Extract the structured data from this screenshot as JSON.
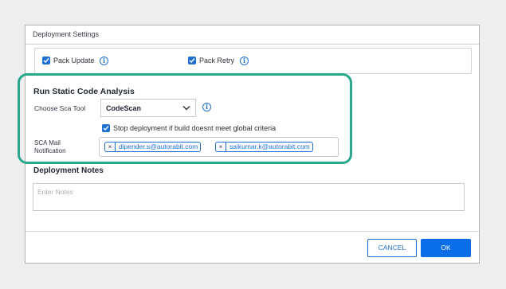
{
  "dialog": {
    "section_title": "Deployment Settings",
    "options": {
      "pack_update": {
        "label": "Pack Update",
        "checked": true
      },
      "pack_retry": {
        "label": "Pack Retry",
        "checked": true
      },
      "info_icon": "i"
    },
    "sca": {
      "title": "Run Static Code Analysis",
      "tool_label": "Choose Sca Tool",
      "tool_value": "CodeScan",
      "stop_deploy": {
        "label": "Stop deployment if build doesnt meet global criteria",
        "checked": true
      },
      "mail_label_line1": "SCA Mail",
      "mail_label_line2": "Notification",
      "emails": [
        "dipender.s@autorabit.com",
        "saikumar.k@autorabit.com"
      ],
      "remove_glyph": "×"
    },
    "notes": {
      "title": "Deployment Notes",
      "placeholder": "Enter Notes"
    },
    "footer": {
      "cancel_label": "CANCEL",
      "ok_label": "OK"
    }
  },
  "colors": {
    "accent": "#1f6fd1",
    "primary_button": "#0a6ee8",
    "highlight": "#2aa88e",
    "background": "#eeeeee"
  },
  "icons": [
    "checkbox-checked-icon",
    "info-icon",
    "chevron-down-icon",
    "close-icon"
  ]
}
